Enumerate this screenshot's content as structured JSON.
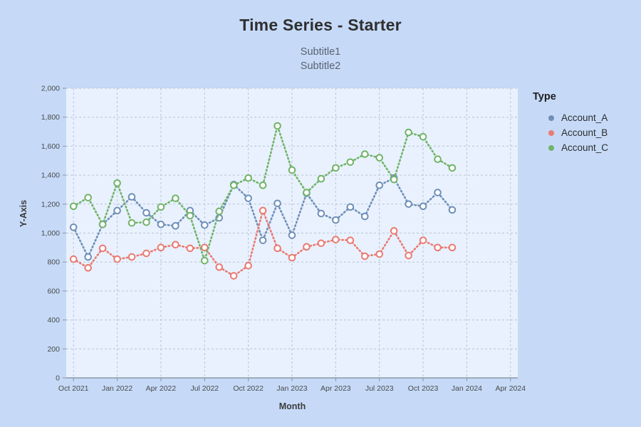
{
  "chart_data": {
    "type": "line",
    "title": "Time Series - Starter",
    "subtitle1": "Subtitle1",
    "subtitle2": "Subtitle2",
    "xlabel": "Month",
    "ylabel": "Y-Axis",
    "legend_title": "Type",
    "legend_position": "right",
    "grid": true,
    "ylim": [
      0,
      2000
    ],
    "y_ticks": [
      0,
      200,
      400,
      600,
      800,
      1000,
      1200,
      1400,
      1600,
      1800,
      2000
    ],
    "y_tick_labels": [
      "0",
      "200",
      "400",
      "600",
      "800",
      "1,000",
      "1,200",
      "1,400",
      "1,600",
      "1,800",
      "2,000"
    ],
    "x_tick_labels": [
      "Oct 2021",
      "Jan 2022",
      "Apr 2022",
      "Jul 2022",
      "Oct 2022",
      "Jan 2023",
      "Apr 2023",
      "Jul 2023",
      "Oct 2023",
      "Jan 2024",
      "Apr 2024"
    ],
    "x_tick_index": [
      0,
      3,
      6,
      9,
      12,
      15,
      18,
      21,
      24,
      27,
      30
    ],
    "x_axis_months": 31,
    "x": [
      "Oct 2021",
      "Nov 2021",
      "Dec 2021",
      "Jan 2022",
      "Feb 2022",
      "Mar 2022",
      "Apr 2022",
      "May 2022",
      "Jun 2022",
      "Jul 2022",
      "Aug 2022",
      "Sep 2022",
      "Oct 2022",
      "Nov 2022",
      "Dec 2022",
      "Jan 2023",
      "Feb 2023",
      "Mar 2023",
      "Apr 2023",
      "May 2023",
      "Jun 2023",
      "Jul 2023",
      "Aug 2023",
      "Sep 2023",
      "Oct 2023",
      "Nov 2023",
      "Dec 2023"
    ],
    "marker": "open-circle",
    "line_style": "dotted",
    "series": [
      {
        "name": "Account_A",
        "color": "#6f8fb8",
        "values": [
          1040,
          835,
          1060,
          1155,
          1250,
          1140,
          1060,
          1050,
          1155,
          1055,
          1105,
          1335,
          1240,
          950,
          1205,
          985,
          1275,
          1135,
          1090,
          1180,
          1115,
          1330,
          1380,
          1200,
          1185,
          1280,
          1160
        ]
      },
      {
        "name": "Account_B",
        "color": "#ea7a72",
        "values": [
          820,
          760,
          895,
          820,
          835,
          860,
          900,
          920,
          895,
          900,
          765,
          705,
          775,
          1155,
          895,
          830,
          905,
          930,
          955,
          950,
          840,
          855,
          1015,
          845,
          950,
          900,
          900
        ]
      },
      {
        "name": "Account_C",
        "color": "#71b368",
        "values": [
          1185,
          1245,
          1060,
          1345,
          1070,
          1075,
          1180,
          1240,
          1120,
          810,
          1150,
          1330,
          1380,
          1330,
          1740,
          1435,
          1280,
          1375,
          1450,
          1490,
          1545,
          1520,
          1370,
          1695,
          1665,
          1510,
          1450
        ]
      }
    ]
  },
  "colors": {
    "page_background": "#c6daf8",
    "plot_background": "#e8f1fd",
    "grid": "#b9c4d4",
    "axis_text": "#4a4a4a",
    "title_text": "#2f2f2f",
    "subtitle_text": "#5a6270"
  }
}
